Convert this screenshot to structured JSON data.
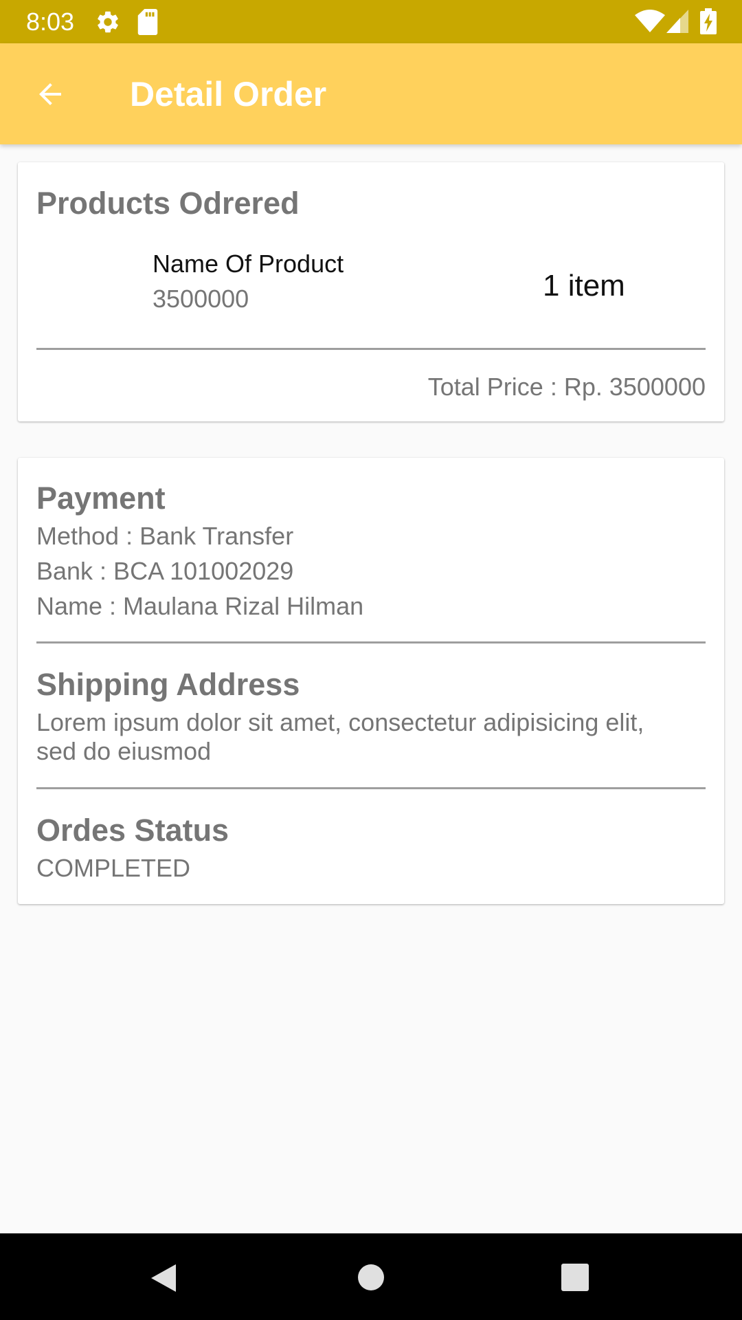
{
  "status_bar": {
    "time": "8:03"
  },
  "app_bar": {
    "title": "Detail Order"
  },
  "products_card": {
    "heading": "Products Odrered",
    "items": [
      {
        "name": "Name Of Product",
        "price": "3500000",
        "quantity": "1 item"
      }
    ],
    "total": "Total Price : Rp. 3500000"
  },
  "payment": {
    "heading": "Payment",
    "method": "Method : Bank Transfer",
    "bank": "Bank : BCA 101002029",
    "name": "Name : Maulana Rizal Hilman"
  },
  "shipping": {
    "heading": "Shipping Address",
    "address_line1": "Lorem ipsum dolor sit amet, consectetur adipisicing elit,",
    "address_line2": "sed do eiusmod"
  },
  "status": {
    "heading": "Ordes Status",
    "value": "COMPLETED"
  },
  "colors": {
    "status_bar": "#c8a800",
    "app_bar": "#ffd15c",
    "text_secondary": "#757575",
    "background": "#fafafa"
  },
  "icons": {
    "status_bar_left": [
      "settings-icon",
      "sd-card-icon"
    ],
    "status_bar_right": [
      "wifi-icon",
      "signal-icon",
      "battery-charging-icon"
    ],
    "app_bar": "arrow-back-icon",
    "navigation": [
      "nav-back-icon",
      "nav-home-icon",
      "nav-recents-icon"
    ]
  }
}
